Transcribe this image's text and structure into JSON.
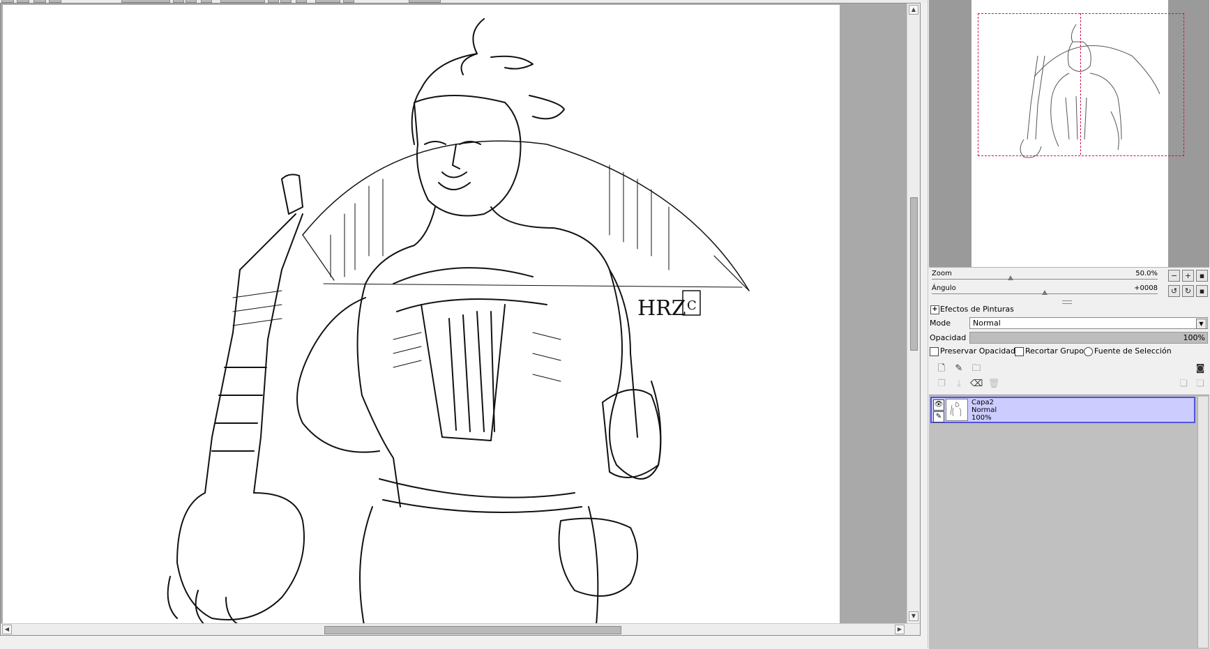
{
  "navigator": {
    "zoom_label": "Zoom",
    "zoom_value": "50.0%",
    "zoom_level": 0.5,
    "angle_label": "Ángulo",
    "angle_value": "+0008"
  },
  "layer_panel": {
    "effects_label": "Efectos de Pinturas",
    "mode_label": "Mode",
    "mode_value": "Normal",
    "opacity_label": "Opacidad",
    "opacity_value": "100%",
    "opacity_level": 1.0,
    "preserve_opacity_label": "Preservar Opacidad",
    "clip_group_label": "Recortar Grupo",
    "selection_source_label": "Fuente de Selección"
  },
  "layers": [
    {
      "name": "Capa2",
      "mode": "Normal",
      "opacity": "100%",
      "selected": true
    }
  ],
  "artwork": {
    "signature": "HRZ",
    "signature_mark": "C"
  },
  "icons": {
    "new_layer": "new-layer-icon",
    "new_vector_layer": "new-vector-layer-icon",
    "new_folder": "new-folder-icon",
    "layer_mask": "layer-mask-icon",
    "visibility": "eye-icon",
    "lock": "pen-icon"
  },
  "colors": {
    "selection_fill": "#ccccff",
    "selection_border": "#5252d8",
    "navigator_frame": "#d01040",
    "canvas_bg": "#a9a9a9"
  }
}
